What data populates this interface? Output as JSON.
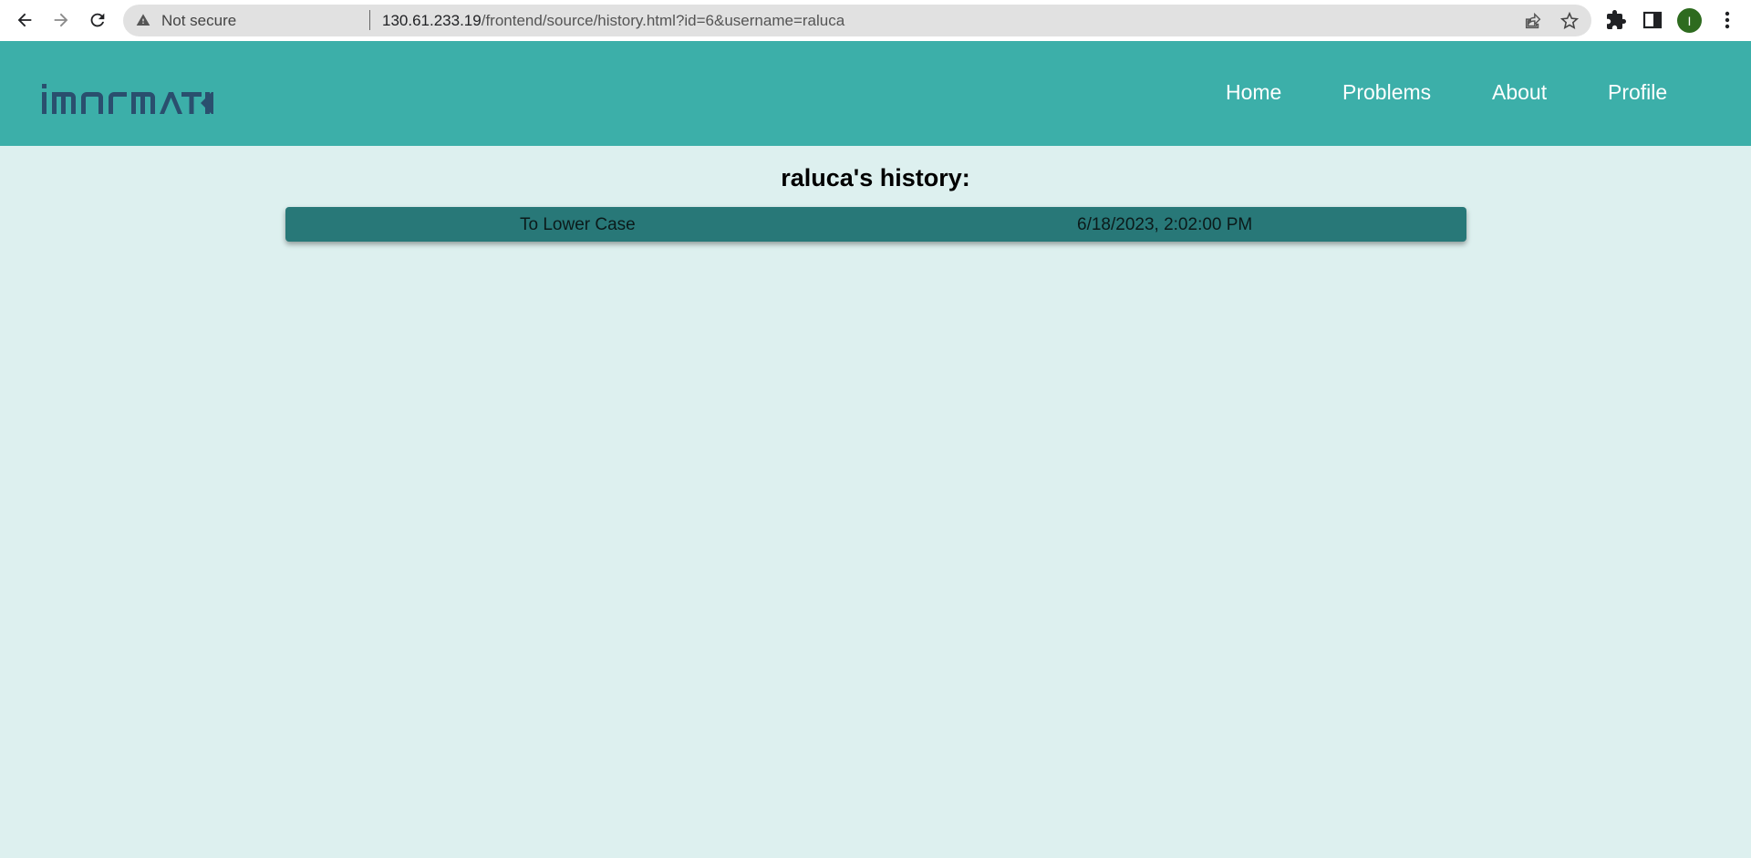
{
  "browser": {
    "security_label": "Not secure",
    "url_host": "130.61.233.19",
    "url_path": "/frontend/source/history.html?id=6&username=raluca",
    "profile_initial": "I",
    "icons": [
      "back-icon",
      "forward-icon",
      "reload-icon",
      "warning-icon",
      "share-icon",
      "star-icon",
      "puzzle-icon",
      "sidebar-icon",
      "more-icon"
    ]
  },
  "site": {
    "logo_text": "imormatix",
    "brand_color": "#3cafa9",
    "nav": {
      "home": "Home",
      "problems": "Problems",
      "about": "About",
      "profile": "Profile"
    }
  },
  "page": {
    "title": "raluca's history:",
    "history": [
      {
        "problem": "To Lower Case",
        "date": "6/18/2023, 2:02:00 PM"
      }
    ],
    "row_color": "#287878",
    "background": "#ddf0ef"
  }
}
